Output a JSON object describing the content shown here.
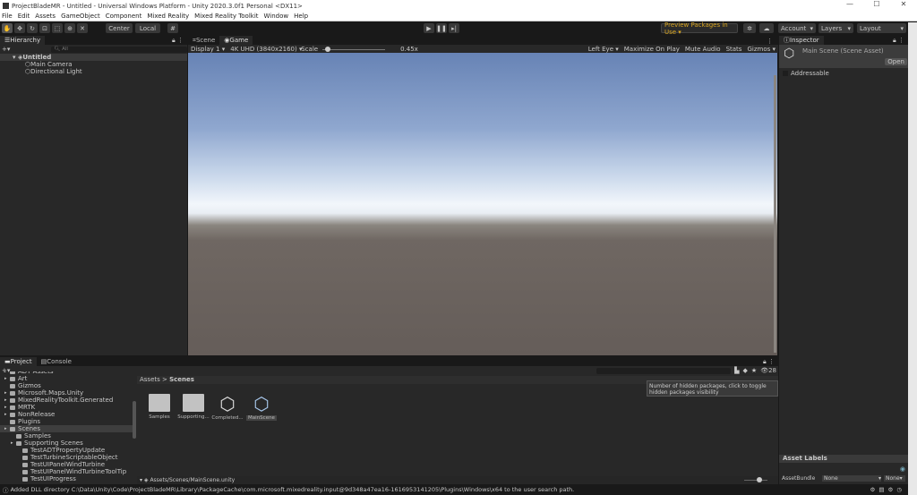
{
  "window": {
    "title": "ProjectBladeMR - Untitled - Universal Windows Platform - Unity 2020.3.0f1 Personal <DX11>",
    "minimize": "—",
    "maximize": "☐",
    "close": "✕"
  },
  "menu": [
    "File",
    "Edit",
    "Assets",
    "GameObject",
    "Component",
    "Mixed Reality",
    "Mixed Reality Toolkit",
    "Window",
    "Help"
  ],
  "toolbar": {
    "center": "Center",
    "local": "Local",
    "preview_packages": "Preview Packages in Use ▾",
    "account": "Account",
    "layers": "Layers",
    "layout": "Layout"
  },
  "hierarchy": {
    "tab": "Hierarchy",
    "search_placeholder": "All",
    "scene": "Untitled",
    "items": [
      "Main Camera",
      "Directional Light"
    ]
  },
  "game": {
    "tabs": [
      "Scene",
      "Game"
    ],
    "display": "Display 1",
    "resolution": "4K UHD (3840x2160)",
    "scale_label": "Scale",
    "scale_value": "0.45x",
    "scale_fraction": 0.05,
    "eye": "Left Eye",
    "maximize": "Maximize On Play",
    "mute": "Mute Audio",
    "stats": "Stats",
    "gizmos": "Gizmos"
  },
  "inspector": {
    "tab": "Inspector",
    "title": "Main Scene (Scene Asset)",
    "open": "Open",
    "addressable": "Addressable",
    "asset_labels": "Asset Labels",
    "assetbundle_label": "AssetBundle",
    "assetbundle_value": "None",
    "variant_value": "None"
  },
  "project": {
    "tabs": [
      "Project",
      "Console"
    ],
    "tree": [
      {
        "label": "ADT Assets",
        "depth": 1,
        "arrow": true
      },
      {
        "label": "Art",
        "depth": 1,
        "arrow": true
      },
      {
        "label": "Gizmos",
        "depth": 1,
        "arrow": false
      },
      {
        "label": "Microsoft.Maps.Unity",
        "depth": 1,
        "arrow": true
      },
      {
        "label": "MixedRealityToolkit.Generated",
        "depth": 1,
        "arrow": true
      },
      {
        "label": "MRTK",
        "depth": 1,
        "arrow": true
      },
      {
        "label": "NonRelease",
        "depth": 1,
        "arrow": true
      },
      {
        "label": "Plugins",
        "depth": 1,
        "arrow": false
      },
      {
        "label": "Scenes",
        "depth": 1,
        "arrow": true,
        "selected": true
      },
      {
        "label": "Samples",
        "depth": 2,
        "arrow": false
      },
      {
        "label": "Supporting Scenes",
        "depth": 2,
        "arrow": true
      },
      {
        "label": "TestADTPropertyUpdate",
        "depth": 3,
        "arrow": false
      },
      {
        "label": "TestTurbineScriptableObject",
        "depth": 3,
        "arrow": false
      },
      {
        "label": "TestUIPanelWindTurbine",
        "depth": 3,
        "arrow": false
      },
      {
        "label": "TestUIPanelWindTurbineToolTip",
        "depth": 3,
        "arrow": false
      },
      {
        "label": "TestUIProgress",
        "depth": 3,
        "arrow": false
      }
    ],
    "breadcrumb": [
      "Assets",
      "Scenes"
    ],
    "assets": [
      {
        "label": "Samples",
        "type": "folder"
      },
      {
        "label": "Supporting...",
        "type": "folder"
      },
      {
        "label": "Completed...",
        "type": "scene"
      },
      {
        "label": "MainScene",
        "type": "scene",
        "selected": true
      }
    ],
    "hidden_count": "28",
    "tooltip": "Number of hidden packages, click to toggle hidden packages visibility",
    "selected_path": "Assets/Scenes/MainScene.unity"
  },
  "status": "Added DLL directory C:\\Data\\Unity\\Code\\ProjectBladeMR\\Library\\PackageCache\\com.microsoft.mixedreality.input@9d348a47ea16-1616953141205\\Plugins\\Windows\\x64 to the user search path."
}
